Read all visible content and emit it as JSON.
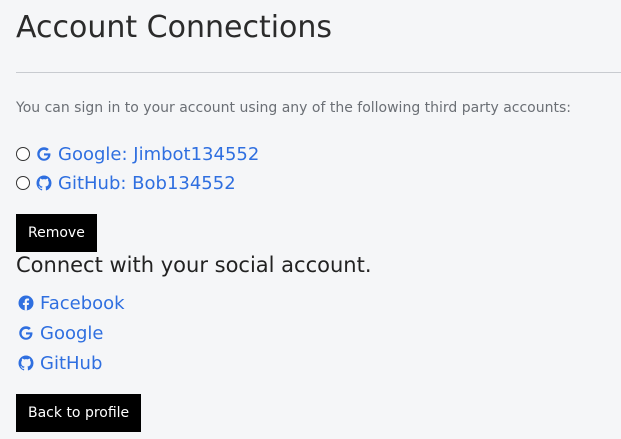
{
  "page": {
    "title": "Account Connections",
    "intro": "You can sign in to your account using any of the following third party accounts:"
  },
  "connections": [
    {
      "provider_icon": "google-icon",
      "label": "Google: Jimbot134552"
    },
    {
      "provider_icon": "github-icon",
      "label": "GitHub: Bob134552"
    }
  ],
  "remove_button": "Remove",
  "connect_section": {
    "title": "Connect with your social account.",
    "providers": [
      {
        "icon": "facebook-icon",
        "label": "Facebook"
      },
      {
        "icon": "google-icon",
        "label": "Google"
      },
      {
        "icon": "github-icon",
        "label": "GitHub"
      }
    ]
  },
  "back_button": "Back to profile",
  "colors": {
    "link": "#2f6fe0",
    "button_bg": "#000000",
    "button_text": "#ffffff",
    "background": "#f5f6f8"
  }
}
